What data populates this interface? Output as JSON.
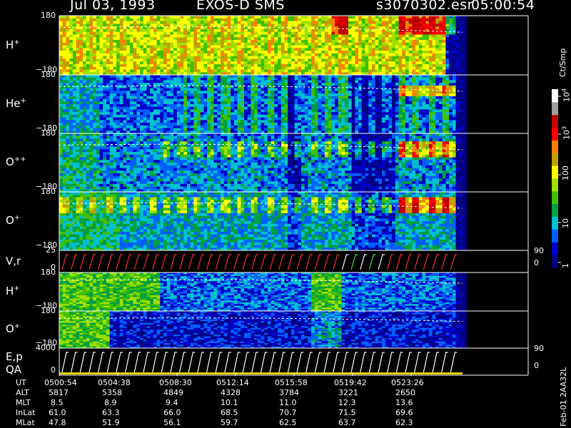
{
  "header": {
    "date": "Jul 03, 1993",
    "instrument": "EXOS-D SMS",
    "file": "s3070302.esr",
    "time": "05:00:54"
  },
  "colors": {
    "background": "#000000",
    "frame": "#ffffff",
    "scale": [
      "#000080",
      "#0000c8",
      "#0060ff",
      "#00c0d0",
      "#00a040",
      "#40c000",
      "#a0e000",
      "#ffff00",
      "#c0a000",
      "#ff8000",
      "#ff0000",
      "#c00000",
      "#a0a0a0",
      "#ffffff"
    ]
  },
  "chart_data": {
    "type": "heatmap",
    "title": "Jul 03, 1993   EXOS-D SMS",
    "file": "s3070302.esr",
    "start_time": "05:00:54",
    "panels": [
      {
        "label": "H",
        "charge": "+",
        "ytop": "180",
        "ybottom": "-180",
        "ylim": [
          -180,
          180
        ]
      },
      {
        "label": "He",
        "charge": "+",
        "ytop": "180",
        "ybottom": "-180",
        "ylim": [
          -180,
          180
        ]
      },
      {
        "label": "O",
        "charge": "++",
        "ytop": "180",
        "ybottom": "-180",
        "ylim": [
          -180,
          180
        ]
      },
      {
        "label": "O",
        "charge": "+",
        "ytop": "180",
        "ybottom": "-180",
        "ylim": [
          -180,
          180
        ]
      },
      {
        "label": "V,r",
        "charge": "",
        "ytop": "25",
        "ybottom": "0",
        "ylim": [
          0,
          25
        ],
        "right_top": "90",
        "right_bottom": "0"
      },
      {
        "label": "H",
        "charge": "+",
        "ytop": "180",
        "ybottom": "-180",
        "ylim": [
          -180,
          180
        ]
      },
      {
        "label": "O",
        "charge": "+",
        "ytop": "180",
        "ybottom": "-180",
        "ylim": [
          -180,
          180
        ]
      },
      {
        "label": "E,p",
        "label2": "QA",
        "charge": "",
        "ytop": "4000",
        "ybottom": "0",
        "ylim": [
          0,
          4000
        ],
        "right_top": "90",
        "right_bottom": "0"
      }
    ],
    "colorbar": {
      "unit": "Ct/Smp",
      "ticks": [
        "1",
        "10",
        "100",
        "10",
        "10"
      ],
      "tick_exponents": [
        "",
        "",
        "",
        "3",
        "4"
      ],
      "scale": "log",
      "range": [
        1,
        10000
      ]
    },
    "footer": {
      "rows": [
        {
          "label": "UT",
          "values": [
            "0500:54",
            "0504:38",
            "0508:30",
            "0512:14",
            "0515:58",
            "0519:42",
            "0523:26"
          ]
        },
        {
          "label": "ALT",
          "values": [
            "5817",
            "5358",
            "4849",
            "4328",
            "3784",
            "3221",
            "2650"
          ]
        },
        {
          "label": "MLT",
          "values": [
            "8.5",
            "8.9",
            "9.4",
            "10.1",
            "11.0",
            "12.3",
            "13.6"
          ]
        },
        {
          "label": "InLat",
          "values": [
            "61.0",
            "63.3",
            "66.0",
            "68.5",
            "70.7",
            "71.5",
            "69.6"
          ]
        },
        {
          "label": "MLat",
          "values": [
            "47.8",
            "51.9",
            "56.1",
            "59.7",
            "62.5",
            "63.7",
            "62.3"
          ]
        }
      ],
      "side_note": "Feb-01 2AA32L"
    }
  }
}
